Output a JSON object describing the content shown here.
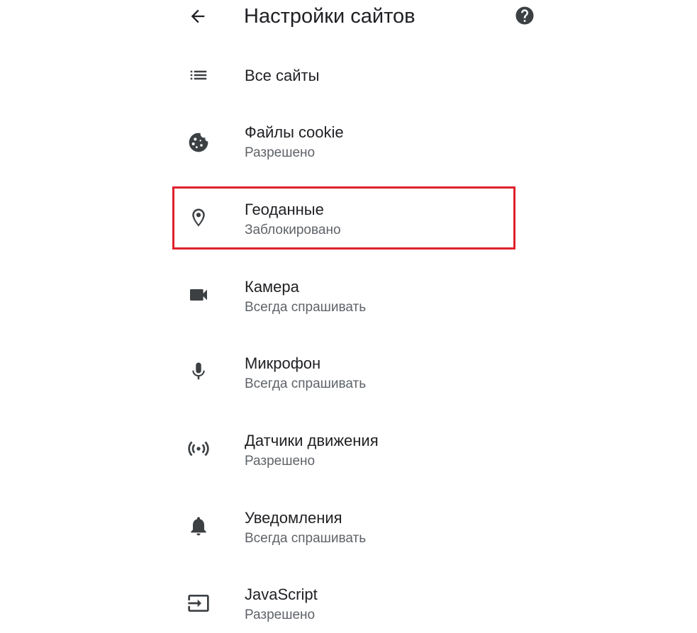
{
  "header": {
    "title": "Настройки сайтов",
    "back_icon": "arrow-back-icon",
    "help_icon": "help-circle-icon"
  },
  "items": [
    {
      "label": "Все сайты",
      "sublabel": "",
      "icon": "list-icon"
    },
    {
      "label": "Файлы cookie",
      "sublabel": "Разрешено",
      "icon": "cookie-icon"
    },
    {
      "label": "Геоданные",
      "sublabel": "Заблокировано",
      "icon": "location-pin-icon",
      "highlighted": true
    },
    {
      "label": "Камера",
      "sublabel": "Всегда спрашивать",
      "icon": "videocam-icon"
    },
    {
      "label": "Микрофон",
      "sublabel": "Всегда спрашивать",
      "icon": "mic-icon"
    },
    {
      "label": "Датчики движения",
      "sublabel": "Разрешено",
      "icon": "sensors-icon"
    },
    {
      "label": "Уведомления",
      "sublabel": "Всегда спрашивать",
      "icon": "bell-icon"
    },
    {
      "label": "JavaScript",
      "sublabel": "Разрешено",
      "icon": "javascript-input-icon"
    }
  ],
  "colors": {
    "text_primary": "#202124",
    "text_secondary": "#5f6368",
    "icon": "#3c4043",
    "highlight_border": "#e0202c",
    "background": "#ffffff"
  }
}
